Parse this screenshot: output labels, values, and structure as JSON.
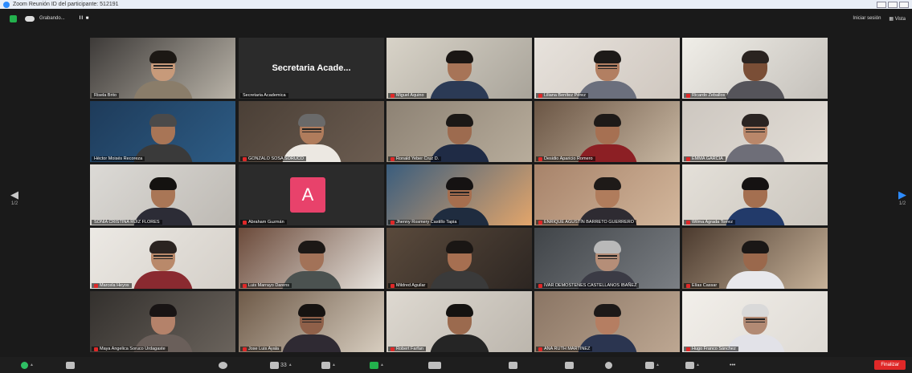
{
  "window": {
    "title": "Zoom Reunión ID del participante: 512191"
  },
  "topbar": {
    "recording_label": "Grabando...",
    "recording_controls": "II ■",
    "start_session": "Iniciar sesión",
    "view": "Vista"
  },
  "secretaria_label": "Secretaria Acade...",
  "avatar_letter": "A",
  "nav": {
    "left_page": "1/2",
    "right_page": "1/2"
  },
  "tiles": [
    {
      "name": "Risela Brito",
      "muted": false
    },
    {
      "name": "Secretaria Academica",
      "muted": false
    },
    {
      "name": "Miguel Aquino",
      "muted": true
    },
    {
      "name": "Liliana Benítez Pérez",
      "muted": true
    },
    {
      "name": "Ricardo Zeballos",
      "muted": true
    },
    {
      "name": "Héctor Moisés Recoreza",
      "muted": false
    },
    {
      "name": "GONZALO SOSA SORUCO",
      "muted": true
    },
    {
      "name": "Ronald Yeber Cruz D.",
      "muted": true
    },
    {
      "name": "Desidio Aparicio Romero",
      "muted": true
    },
    {
      "name": "EMMA GARCIA",
      "muted": true
    },
    {
      "name": "SONIA CRISTINA RUIZ FLORES",
      "muted": false
    },
    {
      "name": "Abraham Guzmán",
      "muted": true
    },
    {
      "name": "Jhenny Rosmery Castillo Tapia",
      "muted": true
    },
    {
      "name": "ENRIQUE AGUSTÍN BARRETO GUERRERO",
      "muted": true
    },
    {
      "name": "Wilma Agrada Torrez",
      "muted": true
    },
    {
      "name": "Marcela Heyos",
      "muted": true
    },
    {
      "name": "Luis Marrayo Darens",
      "muted": true
    },
    {
      "name": "Mildred Aguilar",
      "muted": true
    },
    {
      "name": "IVAR DEMOSTENES CASTELLANOS IBAÑEZ",
      "muted": true
    },
    {
      "name": "Elías Cassar",
      "muted": true
    },
    {
      "name": "Maya Angelica Soruco Urdagaste",
      "muted": true
    },
    {
      "name": "Jose Luis Ayala",
      "muted": true
    },
    {
      "name": "Robert Farfan",
      "muted": true
    },
    {
      "name": "ANA RUTH MARTINEZ",
      "muted": true
    },
    {
      "name": "Hugo Franco Sánchez",
      "muted": true
    }
  ],
  "toolbar": {
    "participants_count": "33",
    "finish": "Finalizar"
  },
  "colors": {
    "accent_blue": "#2d8cff",
    "end_red": "#e02828",
    "active_border": "#e6e84e"
  }
}
